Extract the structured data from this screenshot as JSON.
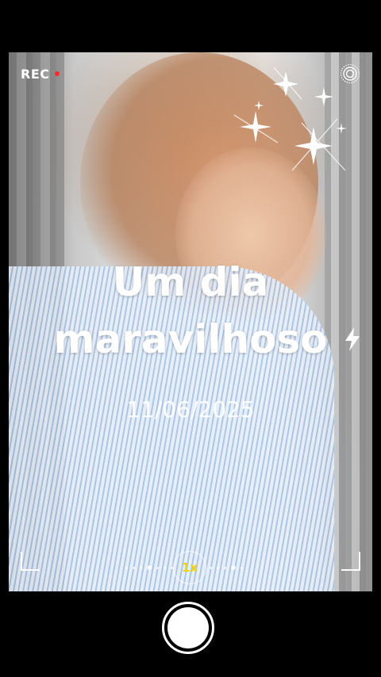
{
  "recorder": {
    "rec_label": "REC",
    "rec_dot_color": "#ff2a2a",
    "live_icon": "live-photo-icon"
  },
  "overlay": {
    "title_line1": "Um dia",
    "title_line2": "maravilhoso",
    "date": "11/06/2025",
    "flash_icon": "lightning-bolt-icon",
    "sparkles_icon": "sparkles-icon"
  },
  "camera": {
    "zoom_label": "1x",
    "zoom_color": "#f4d000",
    "shutter_icon": "shutter-button"
  }
}
